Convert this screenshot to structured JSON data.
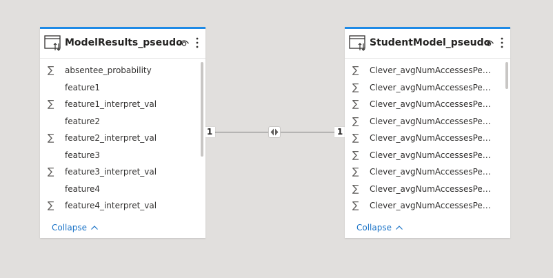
{
  "tables": [
    {
      "title": "ModelResults_pseudo",
      "fields": [
        {
          "label": "absentee_probability",
          "summable": true
        },
        {
          "label": "feature1",
          "summable": false
        },
        {
          "label": "feature1_interpret_val",
          "summable": true
        },
        {
          "label": "feature2",
          "summable": false
        },
        {
          "label": "feature2_interpret_val",
          "summable": true
        },
        {
          "label": "feature3",
          "summable": false
        },
        {
          "label": "feature3_interpret_val",
          "summable": true
        },
        {
          "label": "feature4",
          "summable": false
        },
        {
          "label": "feature4_interpret_val",
          "summable": true
        }
      ],
      "collapse_label": "Collapse"
    },
    {
      "title": "StudentModel_pseudo",
      "fields": [
        {
          "label": "Clever_avgNumAccessesPerDa...",
          "summable": true
        },
        {
          "label": "Clever_avgNumAccessesPerDa...",
          "summable": true
        },
        {
          "label": "Clever_avgNumAccessesPerDa...",
          "summable": true
        },
        {
          "label": "Clever_avgNumAccessesPerDa...",
          "summable": true
        },
        {
          "label": "Clever_avgNumAccessesPerDa...",
          "summable": true
        },
        {
          "label": "Clever_avgNumAccessesPerDa...",
          "summable": true
        },
        {
          "label": "Clever_avgNumAccessesPerDa...",
          "summable": true
        },
        {
          "label": "Clever_avgNumAccessesPerDa...",
          "summable": true
        },
        {
          "label": "Clever_avgNumAccessesPerDa...",
          "summable": true
        }
      ],
      "collapse_label": "Collapse"
    }
  ],
  "relationship": {
    "left_cardinality": "1",
    "right_cardinality": "1",
    "cross_filter": "both-directions-icon"
  },
  "icons": {
    "sum": "∑",
    "table": "table-icon",
    "visibility": "eye-icon",
    "more": "more-options-icon",
    "collapse_chevron": "chevron-up-icon"
  },
  "colors": {
    "accent": "#1e8ae6",
    "link": "#1a73c7",
    "canvas": "#e1dfdd"
  }
}
